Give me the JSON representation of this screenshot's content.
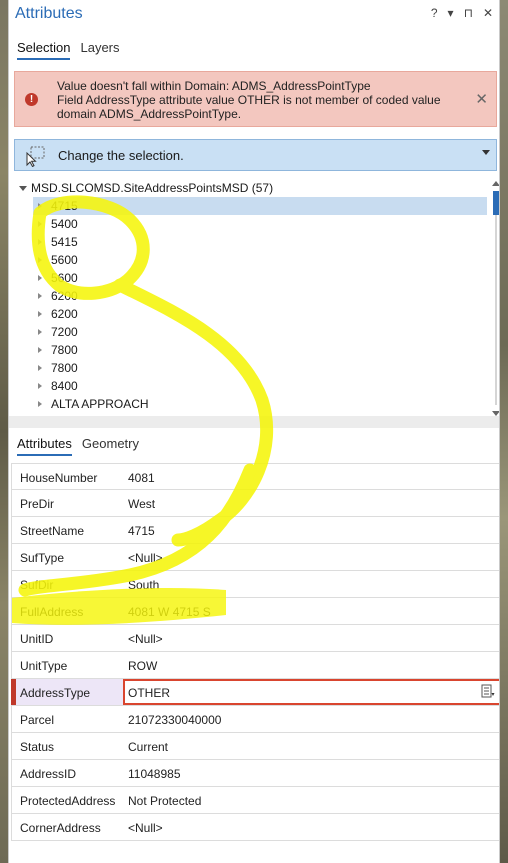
{
  "window": {
    "title": "Attributes",
    "buttons": [
      "?",
      "▾",
      "⊓",
      "✕"
    ]
  },
  "top_tabs": [
    {
      "label": "Selection",
      "active": true
    },
    {
      "label": "Layers",
      "active": false
    }
  ],
  "error": {
    "line1": "Value doesn't fall within Domain: ADMS_AddressPointType",
    "line2": "Field AddressType attribute value OTHER is not member of coded value",
    "line3": "domain ADMS_AddressPointType.",
    "icon": "error-icon",
    "close": "✕"
  },
  "selection": {
    "label": "Change the selection."
  },
  "tree": {
    "root": "MSD.SLCOMSD.SiteAddressPointsMSD (57)",
    "items": [
      "4715",
      "5400",
      "5415",
      "5600",
      "5600",
      "6200",
      "6200",
      "7200",
      "7800",
      "7800",
      "8400",
      "ALTA APPROACH"
    ],
    "selected_index": 0
  },
  "lower_tabs": [
    {
      "label": "Attributes",
      "active": true
    },
    {
      "label": "Geometry",
      "active": false
    }
  ],
  "attributes": [
    {
      "name": "HouseNumber",
      "value": "4081"
    },
    {
      "name": "PreDir",
      "value": "West"
    },
    {
      "name": "StreetName",
      "value": "4715"
    },
    {
      "name": "SufType",
      "value": "<Null>"
    },
    {
      "name": "SufDir",
      "value": "South"
    },
    {
      "name": "FullAddress",
      "value": "4081 W 4715 S"
    },
    {
      "name": "UnitID",
      "value": "<Null>"
    },
    {
      "name": "UnitType",
      "value": "ROW"
    },
    {
      "name": "AddressType",
      "value": "OTHER",
      "error": true
    },
    {
      "name": "Parcel",
      "value": "21072330040000"
    },
    {
      "name": "Status",
      "value": "Current"
    },
    {
      "name": "AddressID",
      "value": "11048985"
    },
    {
      "name": "ProtectedAddress",
      "value": "Not Protected"
    },
    {
      "name": "CornerAddress",
      "value": "<Null>"
    }
  ],
  "colors": {
    "accent": "#2b6cb6",
    "error_bg": "#f3c7bf",
    "error_red": "#c0392b",
    "highlighter": "#f5f50a"
  }
}
